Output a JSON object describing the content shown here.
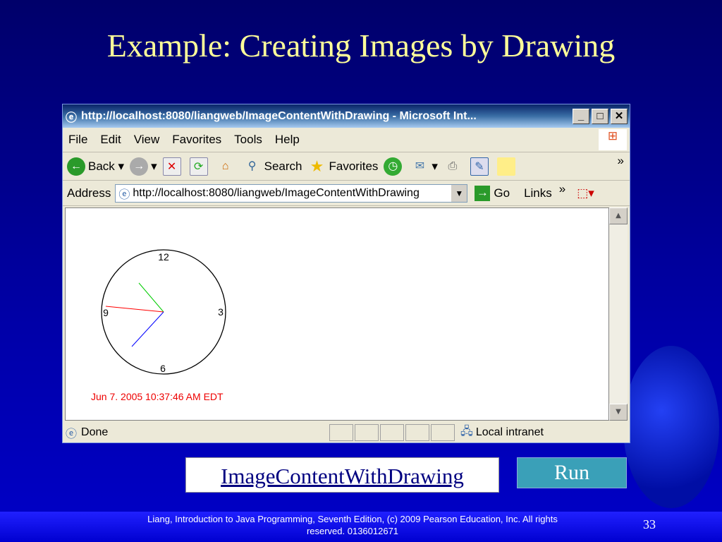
{
  "slide": {
    "title": "Example: Creating Images by Drawing",
    "link_label": "ImageContentWithDrawing",
    "run_label": "Run",
    "footer": "Liang, Introduction to Java Programming, Seventh Edition, (c) 2009 Pearson Education, Inc. All rights reserved. 0136012671",
    "page_number": "33"
  },
  "browser": {
    "title": "http://localhost:8080/liangweb/ImageContentWithDrawing - Microsoft Int...",
    "menu": [
      "File",
      "Edit",
      "View",
      "Favorites",
      "Tools",
      "Help"
    ],
    "toolbar": {
      "back": "Back",
      "search": "Search",
      "favorites": "Favorites",
      "more": "»"
    },
    "address_label": "Address",
    "address_value": "http://localhost:8080/liangweb/ImageContentWithDrawing",
    "go": "Go",
    "links": "Links",
    "links_more": "»",
    "status": "Done",
    "zone": "Local intranet"
  },
  "clock": {
    "n12": "12",
    "n3": "3",
    "n6": "6",
    "n9": "9",
    "datetime": "Jun 7. 2005 10:37:46 AM EDT",
    "colors": {
      "hour": "#00cc00",
      "minute": "#0000ff",
      "second": "#ff0000"
    }
  }
}
